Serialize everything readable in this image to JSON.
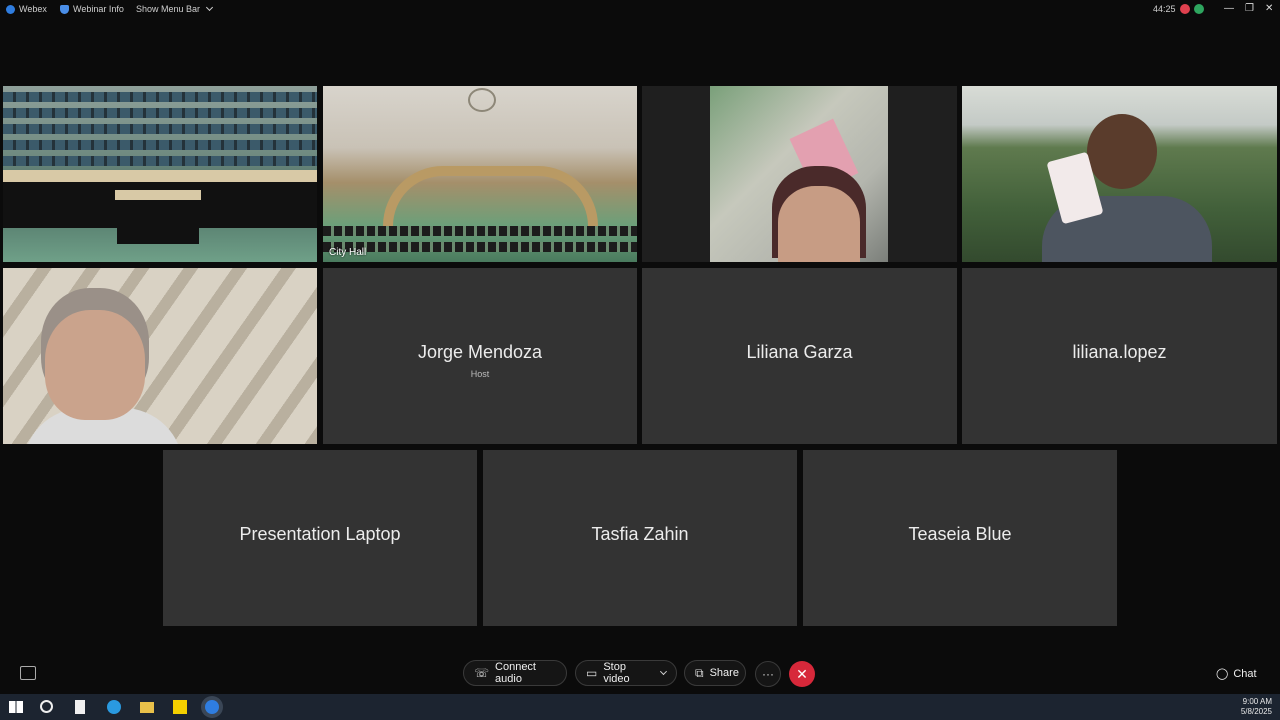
{
  "topbar": {
    "app_name": "Webex",
    "webinar_info": "Webinar Info",
    "show_menu_bar": "Show Menu Bar",
    "status_text": "44:25"
  },
  "tiles": {
    "room_camera": {
      "caption": ""
    },
    "city_hall": {
      "caption": "City Hall"
    },
    "jorge": {
      "name": "Jorge Mendoza",
      "role": "Host"
    },
    "liliana_garza": {
      "name": "Liliana Garza"
    },
    "liliana_lopez": {
      "name": "liliana.lopez"
    },
    "presentation_laptop": {
      "name": "Presentation Laptop"
    },
    "tasfia": {
      "name": "Tasfia Zahin"
    },
    "teaseia": {
      "name": "Teaseia Blue"
    }
  },
  "toolbar": {
    "connect_audio": "Connect audio",
    "stop_video": "Stop video",
    "share": "Share",
    "more": "···",
    "end": "✕",
    "chat": "Chat"
  },
  "taskbar": {
    "time": "9:00 AM",
    "date": "5/8/2025"
  },
  "colors": {
    "end_button": "#d7283a",
    "active_speaker_border": "#7fb4e6",
    "tile_background": "#333333"
  }
}
